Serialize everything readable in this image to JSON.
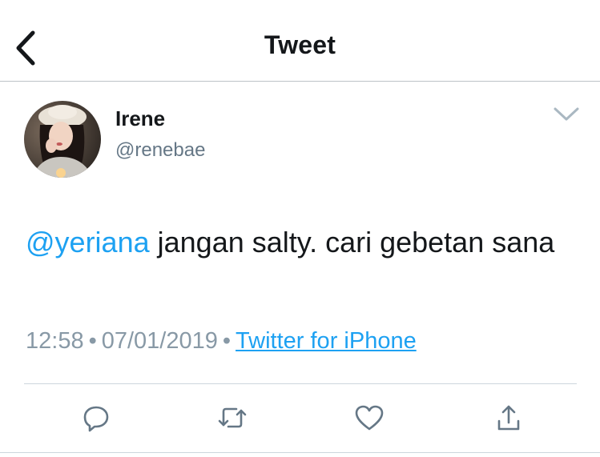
{
  "header": {
    "title": "Tweet",
    "back_icon": "chevron-left-icon"
  },
  "tweet": {
    "author": {
      "name": "Irene",
      "handle": "@renebae"
    },
    "mention": "@yeriana",
    "text": " jangan salty. cari gebetan sana",
    "time": "12:58",
    "date": "07/01/2019",
    "separator": "•",
    "source": "Twitter for iPhone"
  },
  "actions": {
    "reply_icon": "reply-icon",
    "retweet_icon": "retweet-icon",
    "like_icon": "heart-icon",
    "share_icon": "share-icon"
  },
  "colors": {
    "accent": "#1da1f2",
    "text": "#14171a",
    "secondary": "#657786",
    "icon": "#657786"
  }
}
